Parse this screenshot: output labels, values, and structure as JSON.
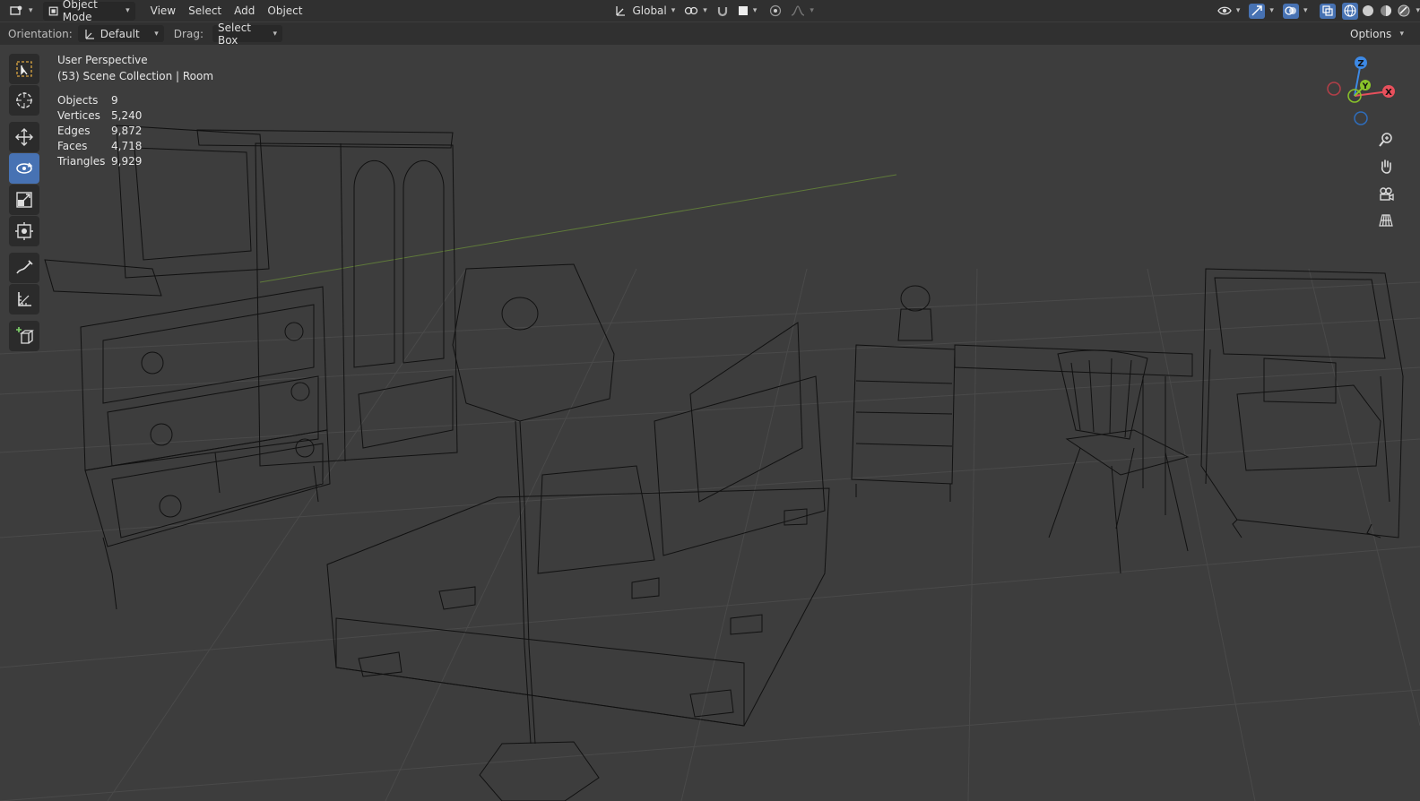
{
  "topbar": {
    "mode": "Object Mode",
    "menus": [
      "View",
      "Select",
      "Add",
      "Object"
    ],
    "transform_orientation": "Global"
  },
  "header": {
    "orientation_label": "Orientation:",
    "orientation_value": "Default",
    "drag_label": "Drag:",
    "drag_value": "Select Box",
    "options_label": "Options"
  },
  "viewport": {
    "view_name": "User Perspective",
    "collection": "(53) Scene Collection | Room",
    "stats": [
      {
        "label": "Objects",
        "value": "9"
      },
      {
        "label": "Vertices",
        "value": "5,240"
      },
      {
        "label": "Edges",
        "value": "9,872"
      },
      {
        "label": "Faces",
        "value": "4,718"
      },
      {
        "label": "Triangles",
        "value": "9,929"
      }
    ]
  },
  "gizmo": {
    "z": "Z",
    "y": "Y",
    "x": "X"
  },
  "colors": {
    "active": "#4772b3",
    "x_axis": "#e8505c",
    "y_axis": "#8ac42a",
    "z_axis": "#3d89e5",
    "grid": "#505050",
    "wire": "#0e0e0e"
  },
  "icons": {
    "toolbar": [
      "select-box-icon",
      "cursor-icon",
      "move-icon",
      "rotate-icon",
      "scale-icon",
      "transform-icon",
      "annotate-icon",
      "measure-icon",
      "add-cube-icon"
    ],
    "nav": [
      "zoom-icon",
      "pan-hand-icon",
      "camera-icon",
      "grid-view-icon"
    ]
  }
}
